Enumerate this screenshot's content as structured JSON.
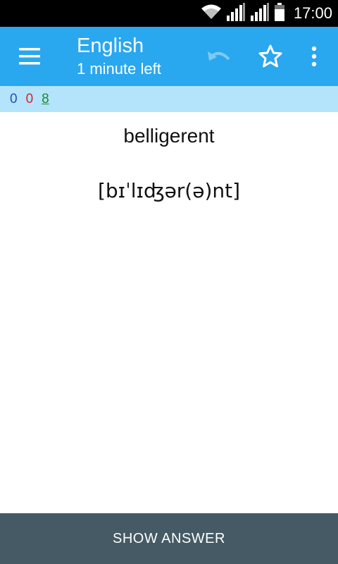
{
  "status_bar": {
    "time": "17:00",
    "icons": [
      "wifi-icon",
      "signal-icon",
      "signal-icon",
      "battery-icon"
    ]
  },
  "app_bar": {
    "title": "English",
    "subtitle": "1 minute left",
    "icons": {
      "menu": "hamburger-menu-icon",
      "undo": "undo-icon",
      "star": "star-outline-icon",
      "overflow": "more-vert-icon"
    },
    "colors": {
      "background": "#29a7ef",
      "undo_disabled": "#7fc9f3"
    }
  },
  "counts": {
    "new": "0",
    "learning": "0",
    "review": "8",
    "colors": {
      "new": "#1f4fb5",
      "learning": "#d2262b",
      "review": "#1b8a2f",
      "background": "#b4e4fb"
    }
  },
  "card": {
    "word": "belligerent",
    "pronunciation": "[bɪˈlɪʤər(ə)nt]"
  },
  "bottom": {
    "show_answer_label": "SHOW ANSWER",
    "background": "#455a64"
  }
}
